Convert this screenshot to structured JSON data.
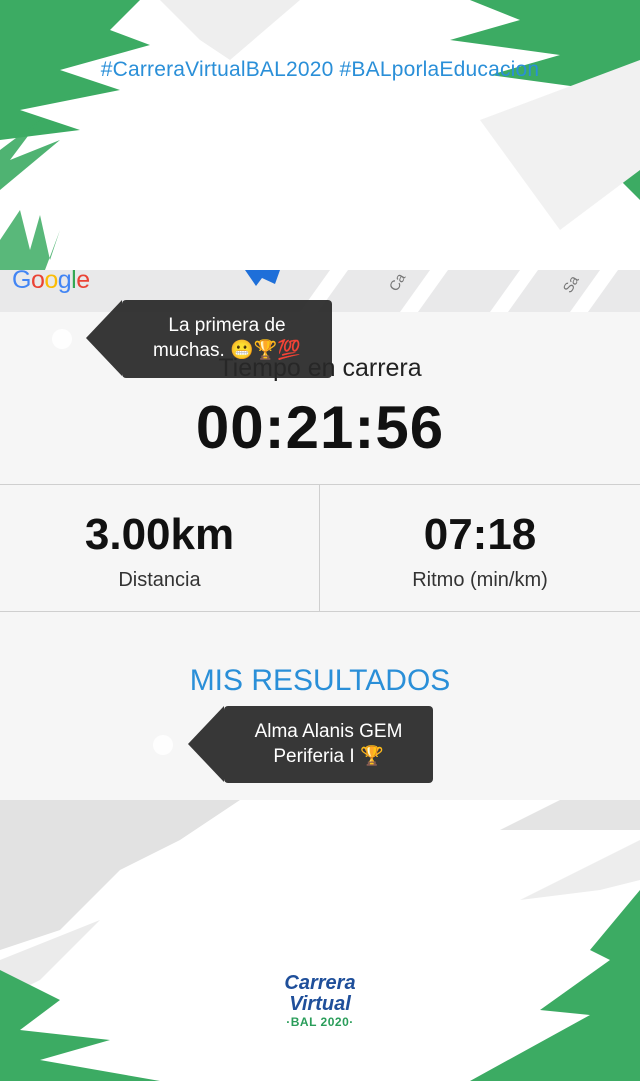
{
  "header": {
    "hashtags": "#CarreraVirtualBAL2020 #BALporlaEducacion"
  },
  "map": {
    "provider_logo": "Google",
    "street_label_1": "Ca",
    "street_label_2": "Sa"
  },
  "stats": {
    "time_label": "Tiempo en carrera",
    "time_value": "00:21:56",
    "distance_value": "3.00km",
    "distance_label": "Distancia",
    "pace_value": "07:18",
    "pace_label": "Ritmo (min/km)"
  },
  "results_link": "MIS RESULTADOS",
  "overlays": {
    "caption_1_line1": "La primera de",
    "caption_1_line2": "muchas. 😬🏆💯",
    "caption_2_line1": "Alma Alanis GEM",
    "caption_2_line2": "Periferia I 🏆"
  },
  "logo": {
    "line1": "Carrera",
    "line2": "Virtual",
    "line3": "·BAL 2020·"
  },
  "colors": {
    "accent_blue": "#2a8fd8",
    "brand_green": "#3cab63",
    "panel_bg": "#f6f6f6"
  }
}
